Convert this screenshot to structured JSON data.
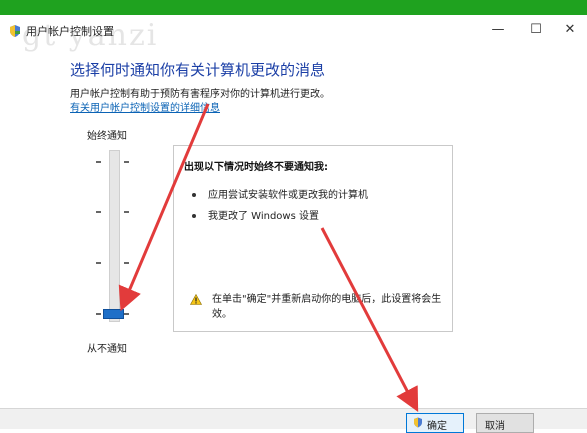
{
  "window": {
    "title": "用户帐户控制设置",
    "minimize_glyph": "—",
    "maximize_glyph": "☐",
    "close_glyph": "✕",
    "watermark": "gt yanzi"
  },
  "main": {
    "heading": "选择何时通知你有关计算机更改的消息",
    "description": "用户帐户控制有助于预防有害程序对你的计算机进行更改。",
    "link": "有关用户帐户控制设置的详细信息"
  },
  "slider": {
    "top_label": "始终通知",
    "bottom_label": "从不通知",
    "level": 0,
    "levels": 4
  },
  "info_panel": {
    "title": "出现以下情况时始终不要通知我:",
    "bullets": [
      "应用尝试安装软件或更改我的计算机",
      "我更改了 Windows 设置"
    ],
    "warning": "在单击\"确定\"并重新启动你的电脑后，此设置将会生效。"
  },
  "buttons": {
    "ok": "确定",
    "cancel": "取消"
  },
  "colors": {
    "accent": "#1e6fc8",
    "heading": "#1b3fa6",
    "link": "#0b63b5",
    "annotation_arrow": "#e23b3b",
    "top_strip": "#1fa21f"
  }
}
